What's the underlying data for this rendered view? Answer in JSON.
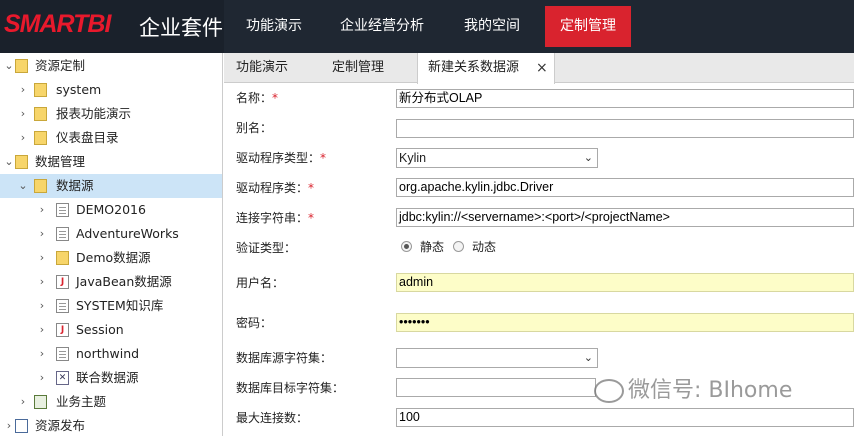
{
  "header": {
    "logo_text": "SMARTBI",
    "logo_sub": "企业套件",
    "nav": [
      "功能演示",
      "企业经营分析",
      "我的空间",
      "定制管理"
    ],
    "active_nav": "定制管理",
    "colors": {
      "bg": "#1f2732",
      "accent": "#d9232e"
    }
  },
  "sidebar": {
    "items": [
      {
        "label": "资源定制",
        "icon": "folder-icon"
      },
      {
        "label": "system",
        "icon": "folder-icon"
      },
      {
        "label": "报表功能演示",
        "icon": "folder-lock-icon"
      },
      {
        "label": "仪表盘目录",
        "icon": "folder-icon"
      },
      {
        "label": "数据管理",
        "icon": "data-icon"
      },
      {
        "label": "数据源",
        "icon": "datasource-icon"
      },
      {
        "label": "DEMO2016",
        "icon": "database-icon"
      },
      {
        "label": "AdventureWorks",
        "icon": "database-icon"
      },
      {
        "label": "Demo数据源",
        "icon": "database-icon"
      },
      {
        "label": "JavaBean数据源",
        "icon": "java-icon"
      },
      {
        "label": "SYSTEM知识库",
        "icon": "database-icon"
      },
      {
        "label": "Session",
        "icon": "java-icon"
      },
      {
        "label": "northwind",
        "icon": "database-icon"
      },
      {
        "label": "联合数据源",
        "icon": "union-icon"
      },
      {
        "label": "业务主题",
        "icon": "business-icon"
      },
      {
        "label": "资源发布",
        "icon": "publish-icon"
      }
    ]
  },
  "tabs": [
    {
      "label": "功能演示"
    },
    {
      "label": "定制管理"
    },
    {
      "label": "新建关系数据源",
      "close": "×"
    }
  ],
  "form": {
    "name_label": "名称：",
    "name_value": "新分布式OLAP",
    "alias_label": "别名：",
    "alias_value": "",
    "driver_type_label": "驱动程序类型：",
    "driver_type_value": "Kylin",
    "driver_class_label": "驱动程序类：",
    "driver_class_value": "org.apache.kylin.jdbc.Driver",
    "conn_label": "连接字符串：",
    "conn_value": "jdbc:kylin://<servername>:<port>/<projectName>",
    "auth_label": "验证类型：",
    "auth_static": "静态",
    "auth_dynamic": "动态",
    "user_label": "用户名：",
    "user_value": "admin",
    "pwd_label": "密码：",
    "pwd_value": "•••••••",
    "src_charset_label": "数据库源字符集：",
    "src_charset_value": "",
    "tgt_charset_label": "数据库目标字符集：",
    "tgt_charset_value": "",
    "max_conn_label": "最大连接数：",
    "max_conn_value": "100",
    "required_mark": "*"
  },
  "watermark": "微信号: BIhome"
}
